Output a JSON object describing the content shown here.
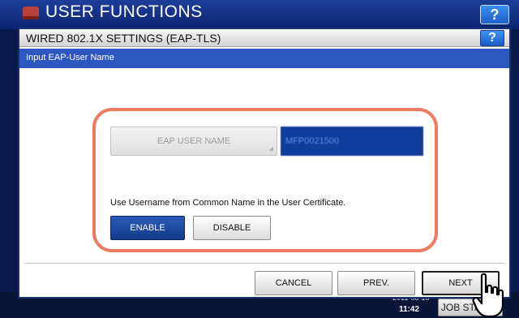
{
  "app": {
    "title": "USER FUNCTIONS",
    "help_label": "?"
  },
  "dialog": {
    "title": "WIRED 802.1X SETTINGS (EAP-TLS)",
    "help_label": "?",
    "subtitle": "Input EAP-User Name"
  },
  "eap": {
    "user_name_button_label": "EAP USER NAME",
    "user_name_value": "MFP0021500"
  },
  "common_name": {
    "label": "Use Username from Common Name in the User Certificate.",
    "enable_label": "ENABLE",
    "disable_label": "DISABLE",
    "selected": "ENABLE"
  },
  "footer": {
    "cancel_label": "CANCEL",
    "prev_label": "PREV.",
    "next_label": "NEXT"
  },
  "status": {
    "date": "2011-08-18",
    "time": "11:42",
    "job_status_label": "JOB STATUS"
  },
  "colors": {
    "highlight_frame": "#ee7a5f",
    "title_bar_blue": "#2e56c0",
    "selected_button": "#1c4aa6"
  }
}
